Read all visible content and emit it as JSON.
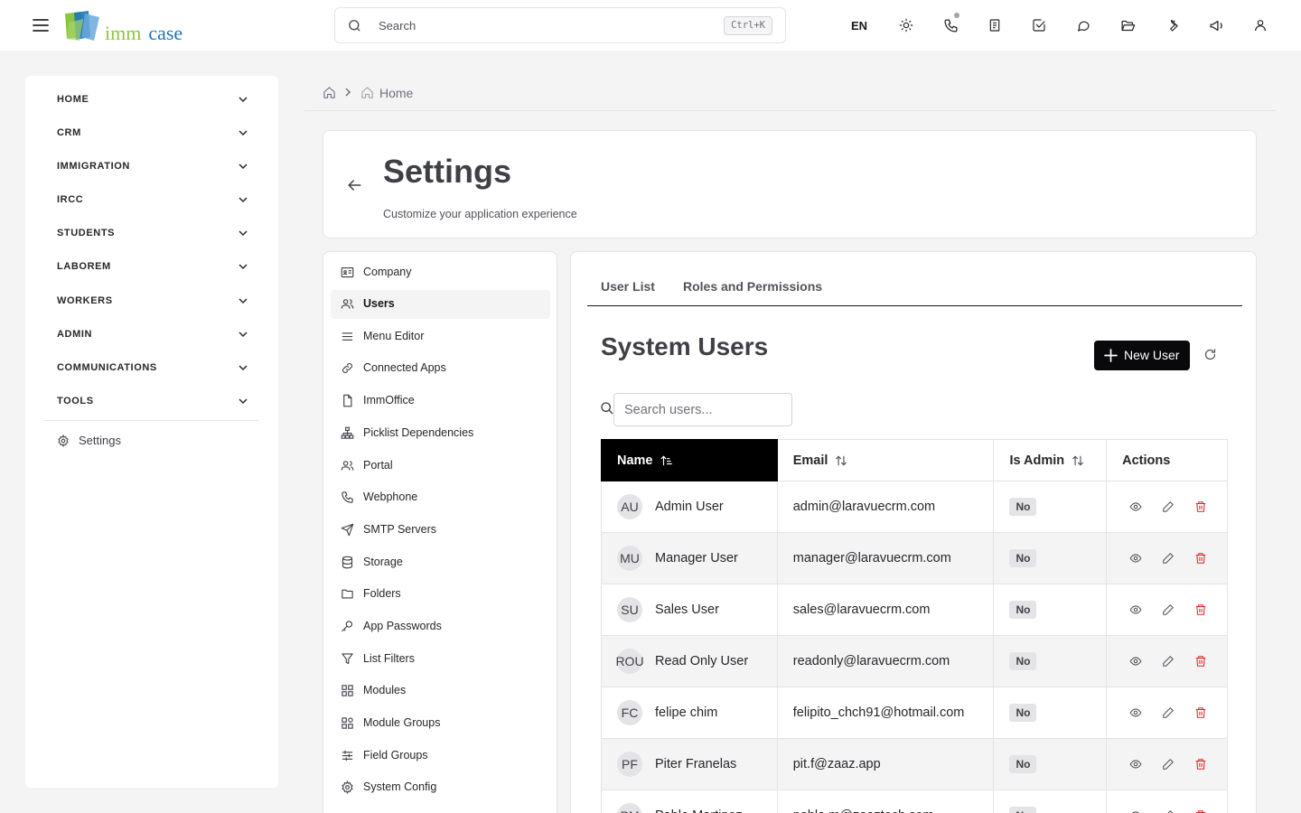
{
  "topbar": {
    "search_placeholder": "Search",
    "search_shortcut": "Ctrl+K",
    "language": "EN",
    "logo_text_1": "imm",
    "logo_text_2": "case",
    "icons": [
      "sun-icon",
      "phone-icon",
      "document-icon",
      "check-square-icon",
      "chat-icon",
      "folder-open-icon",
      "wrench-icon",
      "megaphone-icon",
      "user-icon"
    ]
  },
  "sidebar": {
    "items": [
      {
        "label": "HOME"
      },
      {
        "label": "CRM"
      },
      {
        "label": "IMMIGRATION"
      },
      {
        "label": "IRCC"
      },
      {
        "label": "STUDENTS"
      },
      {
        "label": "LABOREM"
      },
      {
        "label": "WORKERS"
      },
      {
        "label": "ADMIN"
      },
      {
        "label": "COMMUNICATIONS"
      },
      {
        "label": "TOOLS"
      }
    ],
    "settings_label": "Settings"
  },
  "breadcrumb": {
    "current": "Home"
  },
  "header": {
    "title": "Settings",
    "subtitle": "Customize your application experience"
  },
  "settings_menu": {
    "items": [
      {
        "label": "Company",
        "icon": "id-card-icon"
      },
      {
        "label": "Users",
        "icon": "users-icon",
        "active": true
      },
      {
        "label": "Menu Editor",
        "icon": "menu-lines-icon"
      },
      {
        "label": "Connected Apps",
        "icon": "link-icon"
      },
      {
        "label": "ImmOffice",
        "icon": "file-icon"
      },
      {
        "label": "Picklist Dependencies",
        "icon": "hierarchy-icon"
      },
      {
        "label": "Portal",
        "icon": "users-icon"
      },
      {
        "label": "Webphone",
        "icon": "phone-icon"
      },
      {
        "label": "SMTP Servers",
        "icon": "send-icon"
      },
      {
        "label": "Storage",
        "icon": "database-icon"
      },
      {
        "label": "Folders",
        "icon": "folder-icon"
      },
      {
        "label": "App Passwords",
        "icon": "key-icon"
      },
      {
        "label": "List Filters",
        "icon": "filter-icon"
      },
      {
        "label": "Modules",
        "icon": "grid-icon"
      },
      {
        "label": "Module Groups",
        "icon": "grid-group-icon"
      },
      {
        "label": "Field Groups",
        "icon": "sliders-icon"
      },
      {
        "label": "System Config",
        "icon": "gear-icon"
      }
    ]
  },
  "main": {
    "tabs": [
      {
        "label": "User List"
      },
      {
        "label": "Roles and Permissions"
      }
    ],
    "title": "System Users",
    "new_user_label": "New User",
    "search_placeholder": "Search users...",
    "table": {
      "columns": [
        "Name",
        "Email",
        "Is Admin",
        "Actions"
      ],
      "sorted_column": "Name",
      "rows": [
        {
          "initials": "AU",
          "name": "Admin User",
          "email": "admin@laravuecrm.com",
          "is_admin": "No"
        },
        {
          "initials": "MU",
          "name": "Manager User",
          "email": "manager@laravuecrm.com",
          "is_admin": "No"
        },
        {
          "initials": "SU",
          "name": "Sales User",
          "email": "sales@laravuecrm.com",
          "is_admin": "No"
        },
        {
          "initials": "ROU",
          "name": "Read Only User",
          "email": "readonly@laravuecrm.com",
          "is_admin": "No"
        },
        {
          "initials": "FC",
          "name": "felipe chim",
          "email": "felipito_chch91@hotmail.com",
          "is_admin": "No"
        },
        {
          "initials": "PF",
          "name": "Piter Franelas",
          "email": "pit.f@zaaz.app",
          "is_admin": "No"
        },
        {
          "initials": "PM",
          "name": "Pablo Martinez",
          "email": "pablo.m@zaaztech.com",
          "is_admin": "No"
        }
      ]
    }
  },
  "colors": {
    "primary": "#09090b",
    "danger": "#dc2626",
    "logo_green": "#8cc63f",
    "logo_blue": "#1b75bc"
  }
}
